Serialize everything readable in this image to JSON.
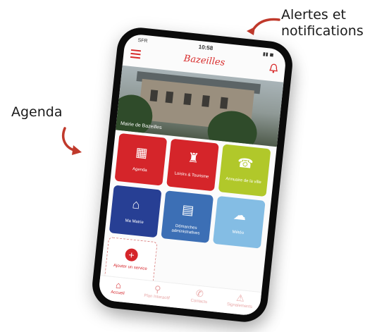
{
  "annotations": {
    "alerts": "Alertes et\nnotifications",
    "alerts_line1": "Alertes et",
    "alerts_line2": "notifications",
    "agenda": "Agenda"
  },
  "phone": {
    "status": {
      "carrier": "SFR",
      "time": "10:58"
    },
    "app_logo": "Bazeilles",
    "hero_caption": "Mairie de Bazeilles",
    "tiles": [
      {
        "label": "Agenda",
        "icon": "calendar-icon",
        "color": "#d5252a"
      },
      {
        "label": "Loisirs & Tourisme",
        "icon": "castle-icon",
        "color": "#d5252a"
      },
      {
        "label": "Annuaire de la ville",
        "icon": "phone-book-icon",
        "color": "#b1c82a"
      },
      {
        "label": "Ma Mairie",
        "icon": "city-hall-icon",
        "color": "#273f94"
      },
      {
        "label": "Démarches administratives",
        "icon": "document-icon",
        "color": "#3c6fb5"
      },
      {
        "label": "Météo",
        "icon": "weather-icon",
        "color": "#84bde4"
      },
      {
        "label": "Ajouter un service",
        "icon": "plus-icon",
        "color": "#d5252a"
      }
    ],
    "tabs": [
      {
        "label": "Accueil",
        "icon": "home-icon"
      },
      {
        "label": "Plan Interactif",
        "icon": "map-pin-icon"
      },
      {
        "label": "Contacts",
        "icon": "phone-icon"
      },
      {
        "label": "Signalements",
        "icon": "warning-icon"
      }
    ]
  }
}
